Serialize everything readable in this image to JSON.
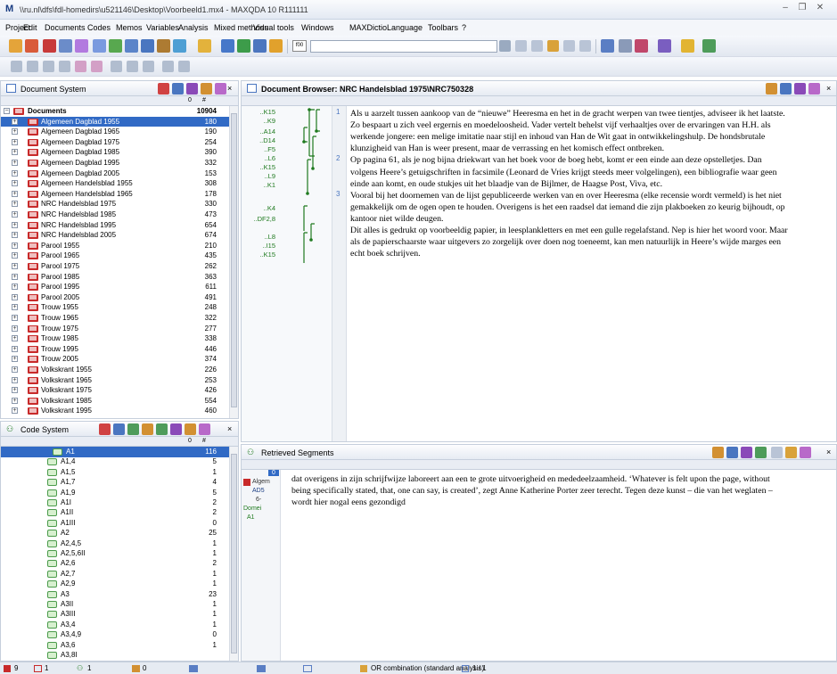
{
  "window": {
    "title": "\\\\ru.nl\\dfs\\fdl-homedirs\\u521146\\Desktop\\Voorbeeld1.mx4 - MAXQDA 10 R111111",
    "logo": "M"
  },
  "menu": [
    "Project",
    "Edit",
    "Documents",
    "Codes",
    "Memos",
    "Variables",
    "Analysis",
    "Mixed methods",
    "Visual tools",
    "Windows",
    "MAXDictio",
    "Language",
    "Toolbars",
    "?"
  ],
  "toolbar": {
    "search_value": "",
    "input_label": "f00"
  },
  "document_system": {
    "title": "Document System",
    "col_marker": "0",
    "col_hash": "#",
    "root": {
      "label": "Documents",
      "count": "10904"
    },
    "items": [
      {
        "label": "Algemeen Dagblad 1955",
        "count": "180",
        "selected": true
      },
      {
        "label": "Algemeen Dagblad 1965",
        "count": "190"
      },
      {
        "label": "Algemeen Dagblad 1975",
        "count": "254"
      },
      {
        "label": "Algemeen Dagblad 1985",
        "count": "390"
      },
      {
        "label": "Algemeen Dagblad 1995",
        "count": "332"
      },
      {
        "label": "Algemeen Dagblad 2005",
        "count": "153"
      },
      {
        "label": "Algemeen Handelsblad 1955",
        "count": "308"
      },
      {
        "label": "Algemeen Handelsblad 1965",
        "count": "178"
      },
      {
        "label": "NRC Handelsblad 1975",
        "count": "330"
      },
      {
        "label": "NRC Handelsblad 1985",
        "count": "473"
      },
      {
        "label": "NRC Handelsblad 1995",
        "count": "654"
      },
      {
        "label": "NRC Handelsblad 2005",
        "count": "674"
      },
      {
        "label": "Parool 1955",
        "count": "210"
      },
      {
        "label": "Parool 1965",
        "count": "435"
      },
      {
        "label": "Parool 1975",
        "count": "262"
      },
      {
        "label": "Parool 1985",
        "count": "363"
      },
      {
        "label": "Parool 1995",
        "count": "611"
      },
      {
        "label": "Parool 2005",
        "count": "491"
      },
      {
        "label": "Trouw 1955",
        "count": "248"
      },
      {
        "label": "Trouw 1965",
        "count": "322"
      },
      {
        "label": "Trouw 1975",
        "count": "277"
      },
      {
        "label": "Trouw 1985",
        "count": "338"
      },
      {
        "label": "Trouw 1995",
        "count": "446"
      },
      {
        "label": "Trouw 2005",
        "count": "374"
      },
      {
        "label": "Volkskrant 1955",
        "count": "226"
      },
      {
        "label": "Volkskrant 1965",
        "count": "253"
      },
      {
        "label": "Volkskrant 1975",
        "count": "426"
      },
      {
        "label": "Volkskrant 1985",
        "count": "554"
      },
      {
        "label": "Volkskrant 1995",
        "count": "460"
      }
    ]
  },
  "code_system": {
    "title": "Code System",
    "col_marker": "0",
    "col_hash": "#",
    "items": [
      {
        "label": "A1",
        "count": "116",
        "selected": true,
        "top": true
      },
      {
        "label": "A1,4",
        "count": "5"
      },
      {
        "label": "A1,5",
        "count": "1"
      },
      {
        "label": "A1,7",
        "count": "4"
      },
      {
        "label": "A1,9",
        "count": "5"
      },
      {
        "label": "A1I",
        "count": "2"
      },
      {
        "label": "A1II",
        "count": "2"
      },
      {
        "label": "A1III",
        "count": "0"
      },
      {
        "label": "A2",
        "count": "25"
      },
      {
        "label": "A2,4,5",
        "count": "1"
      },
      {
        "label": "A2,5,6II",
        "count": "1"
      },
      {
        "label": "A2,6",
        "count": "2"
      },
      {
        "label": "A2,7",
        "count": "1"
      },
      {
        "label": "A2,9",
        "count": "1"
      },
      {
        "label": "A3",
        "count": "23"
      },
      {
        "label": "A3II",
        "count": "1"
      },
      {
        "label": "A3III",
        "count": "1"
      },
      {
        "label": "A3,4",
        "count": "1"
      },
      {
        "label": "A3,4,9",
        "count": "0"
      },
      {
        "label": "A3,6",
        "count": "1"
      },
      {
        "label": "A3,8I",
        "count": ""
      }
    ]
  },
  "document_browser": {
    "title": "Document Browser: NRC Handelsblad 1975\\NRC750328",
    "gutter_codes": [
      "..K15",
      "..K9",
      "..A14",
      "..D14",
      "..F5",
      "..L6",
      "..K15",
      "..L9",
      "..K1",
      "..K4",
      "..DF2,8",
      "..L8",
      "..I15",
      "..K15"
    ],
    "paragraphs": [
      {
        "num": "1",
        "lines": [
          "Als u aarzelt tussen aankoop van de “nieuwe” Heeresma en het in de gracht werpen van twee tientjes, adviseer ik het laatste.",
          "Zo bespaart u zich veel ergernis en moedeloosheid. Vader vertelt behelst vijf verhaaltjes over de ervaringen van H.H. als",
          "werkende jongere: een melige imitatie naar stijl en inhoud van Han de Wit gaat in ontwikkelingshulp. De hondsbrutale",
          "klunzigheid van Han is weer present, maar de verrassing en het komisch effect ontbreken."
        ]
      },
      {
        "num": "2",
        "lines": [
          "Op pagina 61, als je nog bijna driekwart van het boek voor de boeg hebt, komt er een einde aan deze opstelletjes. Dan",
          "volgens Heere’s getuigschriften in facsimile (Leonard de Vries krijgt steeds meer volgelingen), een bibliografie waar geen",
          "einde aan komt, en oude stukjes uit het blaadje van de Bijlmer, de Haagse Post, Viva, etc."
        ]
      },
      {
        "num": "3",
        "lines": [
          "Vooral bij het doornemen van de lijst gepubliceerde werken van en over Heeresma (elke recensie wordt vermeld) is het niet",
          "gemakkelijk om de ogen open te houden. Overigens is het een raadsel dat iemand die zijn plakboeken zo keurig bijhoudt, op",
          "kantoor niet wilde deugen.",
          "Dit alles is gedrukt op voorbeeldig papier, in leesplankletters en met een gulle regelafstand. Nep is hier het woord voor. Maar",
          "als de papierschaarste waar uitgevers zo zorgelijk over doen nog toeneemt, kan men natuurlijk in Heere’s wijde marges een",
          "echt boek schrijven."
        ]
      }
    ]
  },
  "retrieved_segments": {
    "title": "Retrieved Segments",
    "meta": [
      "0",
      "Algem",
      "AD5",
      "6-",
      "Domei",
      "A1"
    ],
    "lines": [
      "dat overigens in zijn schrijfwijze laboreert aan een te grote uitvoerigheid en mededeelzaamheid. ‘Whatever is felt upon the page, without",
      "being specifically stated, that, one can say, is created’, zegt Anne Katherine Porter zeer terecht.  Tegen deze kunst – die van het weglaten –",
      "wordt hier nogal eens gezondigd"
    ]
  },
  "statusbar": {
    "docs": "9",
    "codes": "1",
    "sets": "1",
    "memos": "0",
    "analysis": "OR combination (standard analysis)",
    "page": "1 / 1"
  },
  "colors": {
    "accent": "#2e58b7",
    "code_green": "#1f7a1f",
    "doc_red": "#c82a2a",
    "selected": "#316ac5"
  }
}
